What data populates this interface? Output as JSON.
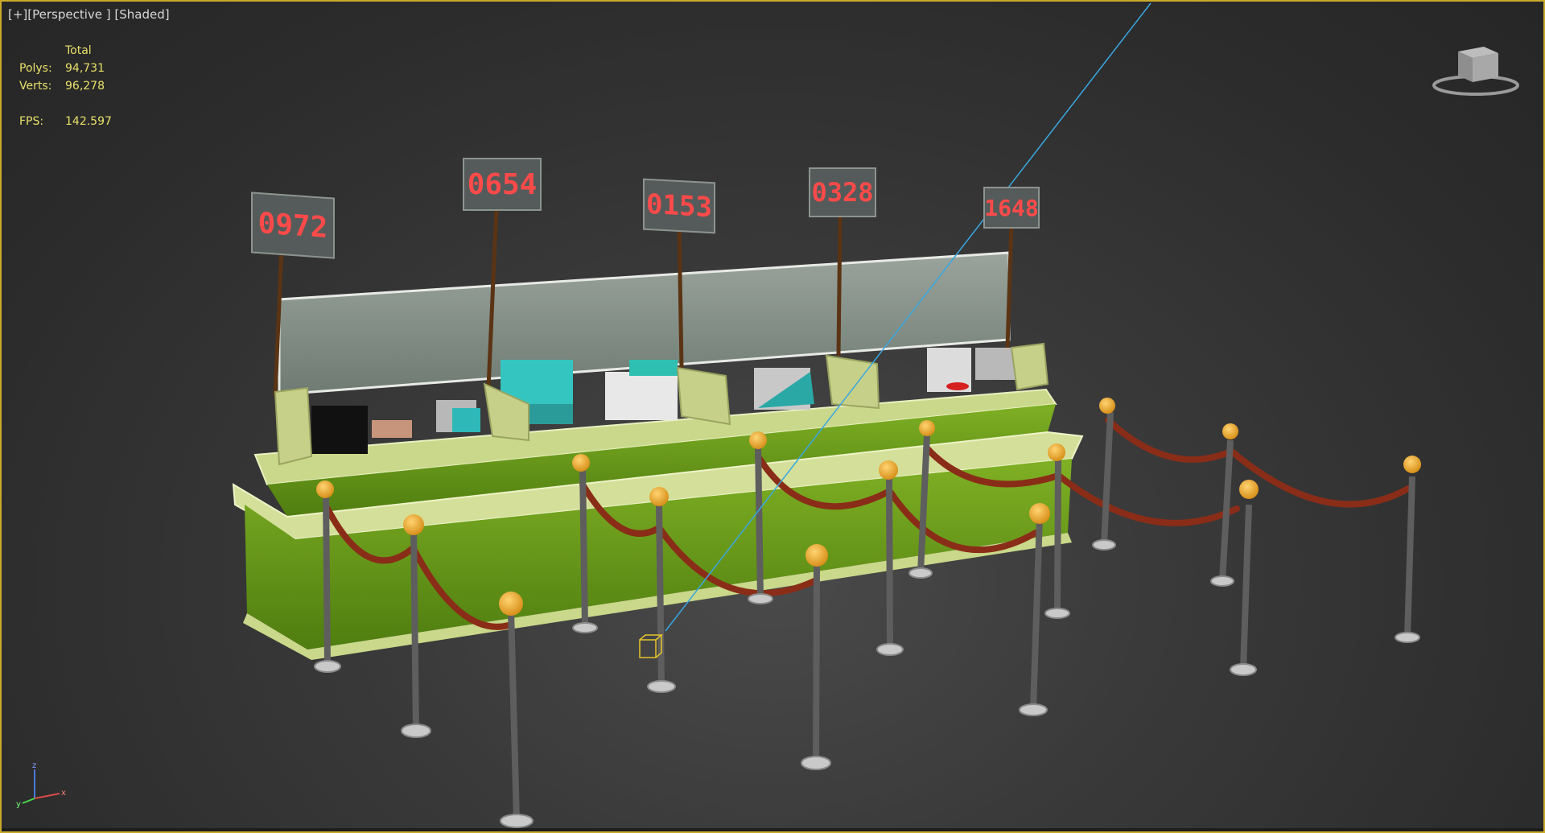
{
  "viewport": {
    "label_plus": "[+]",
    "label_view": "[Perspective ]",
    "label_shading": "[Shaded]",
    "active_border_color": "#c8a92a"
  },
  "stats": {
    "header": "Total",
    "polys_label": "Polys:",
    "polys_value": "94,731",
    "verts_label": "Verts:",
    "verts_value": "96,278",
    "fps_label": "FPS:",
    "fps_value": "142.597",
    "text_color": "#e8e06a"
  },
  "signs": [
    {
      "number": "0972"
    },
    {
      "number": "0654"
    },
    {
      "number": "0153"
    },
    {
      "number": "0328"
    },
    {
      "number": "1648"
    }
  ],
  "viewcube": {
    "icon": "viewcube-icon"
  },
  "axis_gizmo": {
    "z_label": "z",
    "x_label": "x",
    "y_label": "y"
  },
  "colors": {
    "counter_green": "#6f9e1e",
    "counter_top": "#d9e5a3",
    "rope": "#8a2d18",
    "stanchion_ball": "#f2a52a",
    "sign_digits": "#ff4a4a"
  }
}
